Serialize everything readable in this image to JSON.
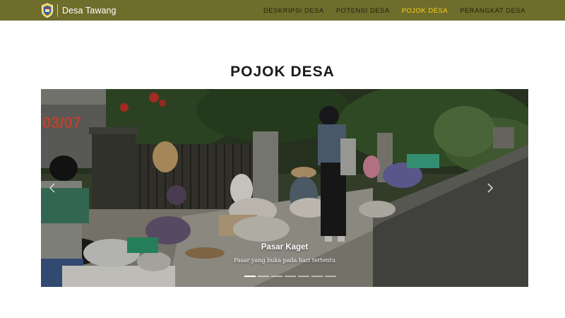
{
  "brand": {
    "name": "Desa Tawang",
    "logo_icon": "village-crest-icon"
  },
  "nav": {
    "items": [
      {
        "label": "DESKRIPSI DESA",
        "active": false
      },
      {
        "label": "POTENSI DESA",
        "active": false
      },
      {
        "label": "POJOK DESA",
        "active": true
      },
      {
        "label": "PERANGKAT DESA",
        "active": false
      }
    ]
  },
  "page": {
    "title": "POJOK DESA"
  },
  "carousel": {
    "slide": {
      "title": "Pasar Kaget",
      "description": "Pasar yang buka pada hari tertentu",
      "sign_text": "03/07"
    },
    "indicators": 7,
    "active_index": 0,
    "prev_icon": "chevron-left-icon",
    "next_icon": "chevron-right-icon"
  },
  "colors": {
    "navbar": "#6f6d2b",
    "active_link": "#ffd31a",
    "link": "#1f1f10",
    "title": "#1b1b1b"
  }
}
